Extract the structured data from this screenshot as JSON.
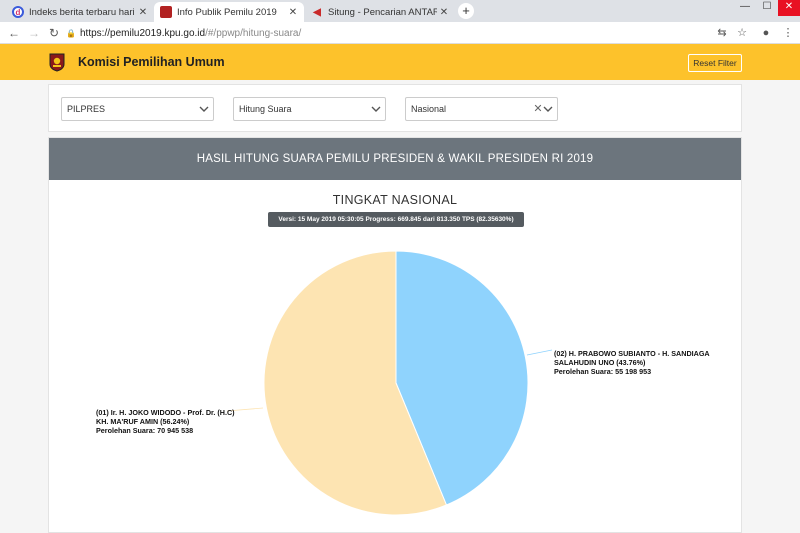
{
  "browser": {
    "tabs": [
      {
        "title": "Indeks berita terbaru hari ini dari",
        "icon": "news-favicon"
      },
      {
        "title": "Info Publik Pemilu 2019",
        "icon": "kpu-favicon"
      },
      {
        "title": "Situng - Pencarian ANTARA News",
        "icon": "antara-favicon"
      }
    ],
    "new_tab": "+",
    "url_host": "https://pemilu2019.kpu.go.id",
    "url_path": "/#/ppwp/hitung-suara/"
  },
  "site": {
    "brand": "Komisi Pemilihan Umum",
    "reset_label": "Reset Filter"
  },
  "filters": {
    "election": "PILPRES",
    "mode": "Hitung Suara",
    "region": "Nasional"
  },
  "results": {
    "heading": "HASIL HITUNG SUARA PEMILU PRESIDEN & WAKIL PRESIDEN RI 2019",
    "level": "TINGKAT NASIONAL",
    "version": "Versi: 15 May 2019 05:30:05 Progress: 669.845 dari 813.350 TPS (82.35630%)"
  },
  "chart_data": {
    "type": "pie",
    "slices": [
      {
        "label_line1": "(02) H. PRABOWO SUBIANTO - H. SANDIAGA",
        "label_line2": "SALAHUDIN UNO (43.76%)",
        "votes_label": "Perolehan Suara: 55 198 953",
        "percent": 43.76,
        "votes": 55198953,
        "color": "#8fd3fd"
      },
      {
        "label_line1": "(01) Ir. H. JOKO WIDODO - Prof. Dr. (H.C)",
        "label_line2": "KH. MA'RUF AMIN (56.24%)",
        "votes_label": "Perolehan Suara: 70 945 538",
        "percent": 56.24,
        "votes": 70945538,
        "color": "#fde4b2"
      }
    ]
  }
}
